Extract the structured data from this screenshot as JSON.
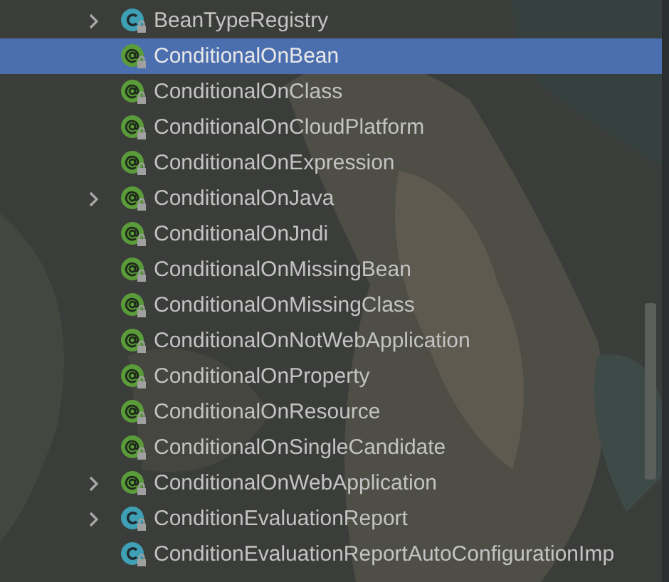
{
  "tree": {
    "items": [
      {
        "label": "BeanTypeRegistry",
        "kind": "class",
        "expandable": true,
        "selected": false
      },
      {
        "label": "ConditionalOnBean",
        "kind": "annotation",
        "expandable": false,
        "selected": true
      },
      {
        "label": "ConditionalOnClass",
        "kind": "annotation",
        "expandable": false,
        "selected": false
      },
      {
        "label": "ConditionalOnCloudPlatform",
        "kind": "annotation",
        "expandable": false,
        "selected": false
      },
      {
        "label": "ConditionalOnExpression",
        "kind": "annotation",
        "expandable": false,
        "selected": false
      },
      {
        "label": "ConditionalOnJava",
        "kind": "annotation",
        "expandable": true,
        "selected": false
      },
      {
        "label": "ConditionalOnJndi",
        "kind": "annotation",
        "expandable": false,
        "selected": false
      },
      {
        "label": "ConditionalOnMissingBean",
        "kind": "annotation",
        "expandable": false,
        "selected": false
      },
      {
        "label": "ConditionalOnMissingClass",
        "kind": "annotation",
        "expandable": false,
        "selected": false
      },
      {
        "label": "ConditionalOnNotWebApplication",
        "kind": "annotation",
        "expandable": false,
        "selected": false
      },
      {
        "label": "ConditionalOnProperty",
        "kind": "annotation",
        "expandable": false,
        "selected": false
      },
      {
        "label": "ConditionalOnResource",
        "kind": "annotation",
        "expandable": false,
        "selected": false
      },
      {
        "label": "ConditionalOnSingleCandidate",
        "kind": "annotation",
        "expandable": false,
        "selected": false
      },
      {
        "label": "ConditionalOnWebApplication",
        "kind": "annotation",
        "expandable": true,
        "selected": false
      },
      {
        "label": "ConditionEvaluationReport",
        "kind": "class",
        "expandable": true,
        "selected": false
      },
      {
        "label": "ConditionEvaluationReportAutoConfigurationImp",
        "kind": "class",
        "expandable": false,
        "selected": false
      }
    ]
  }
}
